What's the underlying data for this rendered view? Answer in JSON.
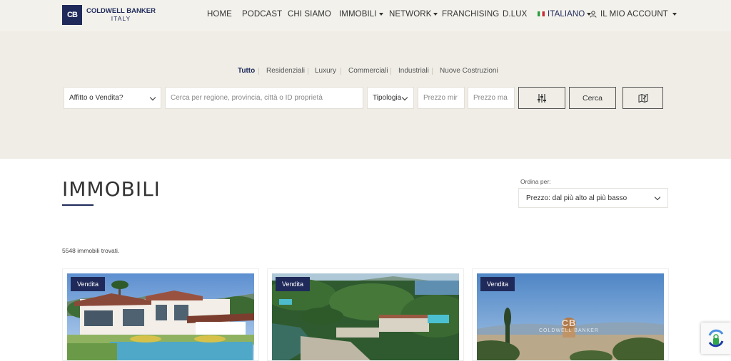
{
  "header": {
    "logo_mark": "CB",
    "logo_line1": "COLDWELL BANKER",
    "logo_line2": "ITALY",
    "nav": {
      "home": "HOME",
      "podcast": "PODCAST",
      "chi_siamo": "CHI SIAMO",
      "immobili": "IMMOBILI",
      "network": "NETWORK",
      "franchising": "FRANCHISING",
      "dlux": "D.LUX",
      "language": "ITALIANO",
      "account": "IL MIO ACCOUNT"
    }
  },
  "search": {
    "tabs": [
      "Tutto",
      "Residenziali",
      "Luxury",
      "Commerciali",
      "Industriali",
      "Nuove Costruzioni"
    ],
    "active_tab": "Tutto",
    "contract_select": "Affitto o Vendita?",
    "location_placeholder": "Cerca per regione, provincia, città o ID proprietà",
    "type_select": "Tipologia",
    "price_min_placeholder": "Prezzo mir",
    "price_max_placeholder": "Prezzo ma",
    "filters_icon": "sliders-icon",
    "search_button": "Cerca",
    "map_icon": "map-icon"
  },
  "main": {
    "title": "IMMOBILI",
    "sort_label": "Ordina per:",
    "sort_value": "Prezzo: dal più alto al più basso",
    "results_count": "5548 immobili trovati."
  },
  "cards": [
    {
      "badge": "Vendita"
    },
    {
      "badge": "Vendita"
    },
    {
      "badge": "Vendita",
      "watermark_line1": "CB",
      "watermark_line2": "COLDWELL BANKER"
    }
  ],
  "colors": {
    "brand_navy": "#1f2a5a",
    "band_beige": "#efede6",
    "header_bg": "#f2f1ec"
  }
}
